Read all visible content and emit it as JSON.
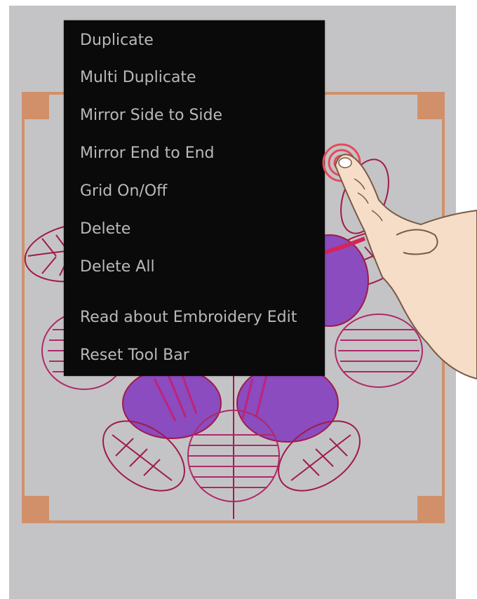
{
  "context_menu": {
    "items": [
      {
        "label": "Duplicate"
      },
      {
        "label": "Multi Duplicate"
      },
      {
        "label": "Mirror Side to Side"
      },
      {
        "label": "Mirror End to End"
      },
      {
        "label": "Grid On/Off"
      },
      {
        "label": "Delete"
      },
      {
        "label": "Delete All"
      },
      {
        "label": "Read about Embroidery Edit"
      },
      {
        "label": "Reset Tool Bar"
      }
    ]
  },
  "colors": {
    "background": "#c4c4c6",
    "hoop": "#d1906a",
    "menu_bg": "#0a0a0a",
    "menu_text": "#b9b9b9",
    "stitch_dark": "#a01a4a",
    "stitch_purple": "#8a4cbf"
  },
  "icons": [
    "touch-indicator-icon",
    "pointing-hand-icon"
  ]
}
